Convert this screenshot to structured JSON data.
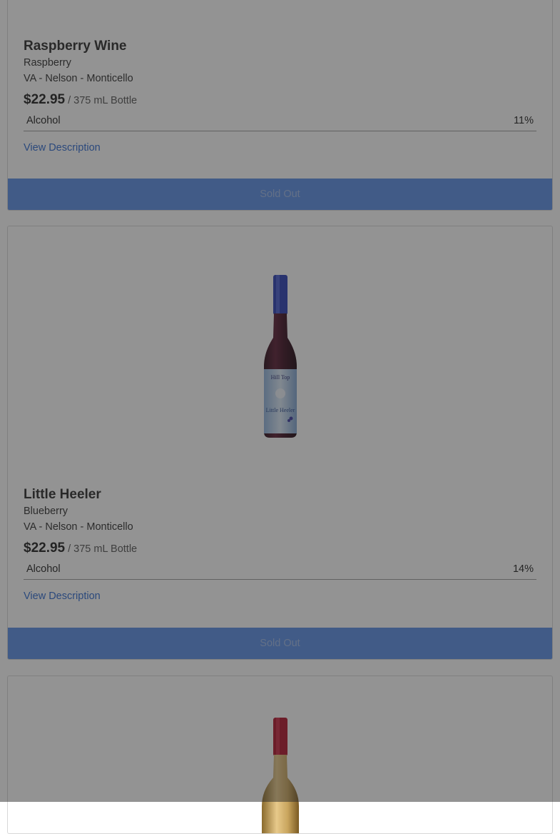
{
  "products": [
    {
      "name": "Raspberry Wine",
      "variety": "Raspberry",
      "region": "VA - Nelson - Monticello",
      "price": "$22.95",
      "unit": "/ 375 mL Bottle",
      "attribute_label": "Alcohol",
      "attribute_value": "11%",
      "description_link": "View Description",
      "button_label": "Sold Out"
    },
    {
      "name": "Little Heeler",
      "variety": "Blueberry",
      "region": "VA - Nelson - Monticello",
      "price": "$22.95",
      "unit": "/ 375 mL Bottle",
      "attribute_label": "Alcohol",
      "attribute_value": "14%",
      "description_link": "View Description",
      "button_label": "Sold Out",
      "label_text": "Hill Top",
      "label_subtext": "Little Heeler"
    }
  ],
  "colors": {
    "accent_blue": "#5b8fe6",
    "link_blue": "#2f6ad0",
    "overlay": "rgba(40,40,40,0.5)"
  }
}
